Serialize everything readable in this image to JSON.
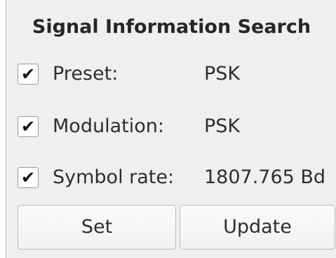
{
  "panel": {
    "title": "Signal Information Search",
    "rows": [
      {
        "checked": true,
        "check_glyph": "✔",
        "label": "Preset:",
        "value": "PSK"
      },
      {
        "checked": true,
        "check_glyph": "✔",
        "label": "Modulation:",
        "value": "PSK"
      },
      {
        "checked": true,
        "check_glyph": "✔",
        "label": "Symbol rate:",
        "value": "1807.765 Bd"
      }
    ],
    "buttons": {
      "set_label": "Set",
      "update_label": "Update"
    }
  }
}
